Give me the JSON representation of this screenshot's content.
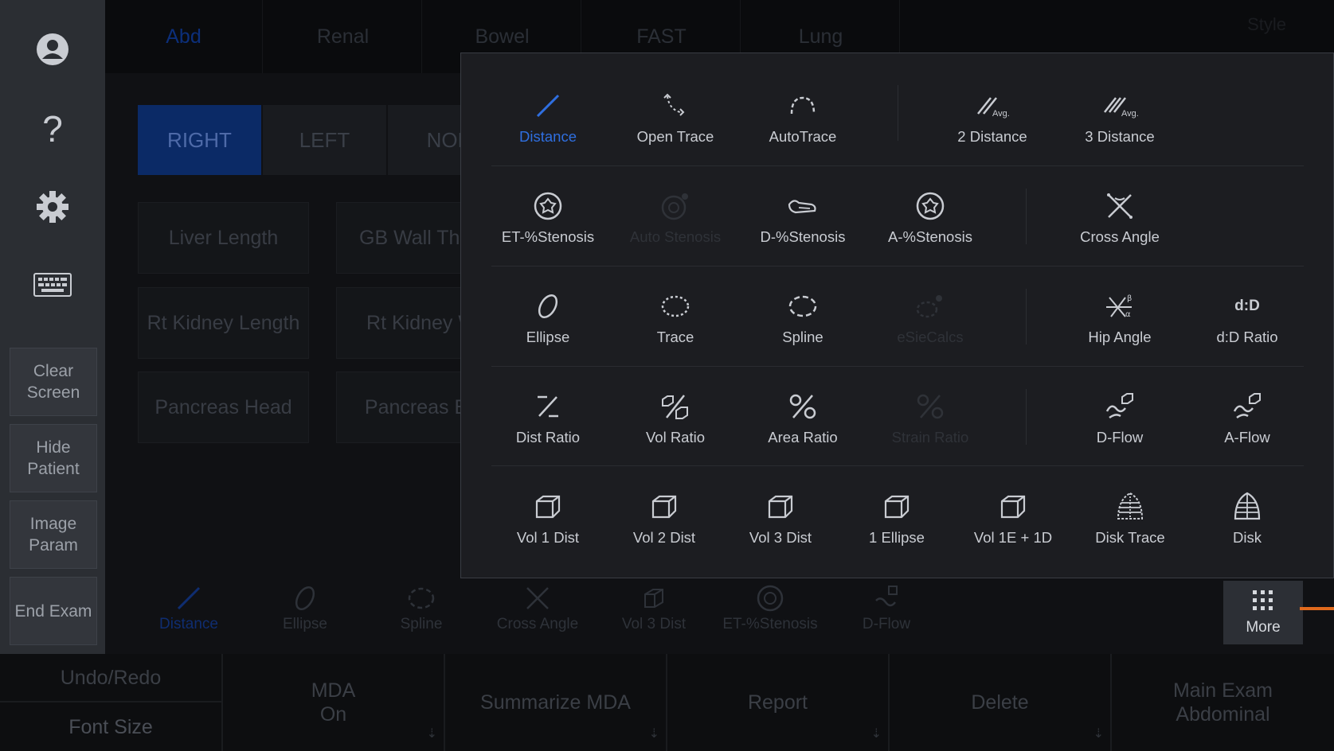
{
  "sidebar": {
    "icons": [
      "user-icon",
      "help-icon",
      "settings-icon",
      "keyboard-icon"
    ],
    "help_glyph": "?",
    "buttons": [
      "Clear\nScreen",
      "Hide\nPatient",
      "Image\nParam",
      "End Exam"
    ]
  },
  "tabs": [
    "Abd",
    "Renal",
    "Bowel",
    "FAST",
    "Lung"
  ],
  "tab_end": "Style",
  "side_toggles": [
    "RIGHT",
    "LEFT",
    "NON"
  ],
  "quick_measures": [
    "Liver Length",
    "GB Wall Thick",
    "Rt  Kidney Length",
    "Rt  Kidney W",
    "Pancreas Head",
    "Pancreas Bo"
  ],
  "tool_strip": [
    "Distance",
    "Ellipse",
    "Spline",
    "Cross Angle",
    "Vol 3 Dist",
    "ET-%Stenosis",
    "D-Flow"
  ],
  "more_label": "More",
  "softkeys": {
    "undo": "Undo/Redo",
    "font": "Font Size",
    "mda": "MDA\nOn",
    "summarize": "Summarize MDA",
    "report": "Report",
    "delete": "Delete",
    "main_exam": "Main Exam\nAbdominal"
  },
  "popup": {
    "row1": [
      "Distance",
      "Open Trace",
      "AutoTrace",
      "2 Distance",
      "3 Distance"
    ],
    "row2": [
      "ET-%Stenosis",
      "Auto Stenosis",
      "D-%Stenosis",
      "A-%Stenosis",
      "Cross Angle"
    ],
    "row3": [
      "Ellipse",
      "Trace",
      "Spline",
      "eSieCalcs",
      "Hip Angle",
      "d:D Ratio"
    ],
    "row4": [
      "Dist Ratio",
      "Vol Ratio",
      "Area Ratio",
      "Strain Ratio",
      "D-Flow",
      "A-Flow"
    ],
    "row5": [
      "Vol 1 Dist",
      "Vol 2 Dist",
      "Vol 3 Dist",
      "1 Ellipse",
      "Vol 1E + 1D",
      "Disk Trace",
      "Disk"
    ],
    "avg_badge": "Avg.",
    "dd_glyph": "d:D",
    "hip_alpha": "α",
    "hip_beta": "β"
  },
  "colors": {
    "accent": "#2f6fe0",
    "panel": "#1c1d21",
    "sidebar": "#2b2e33",
    "orange": "#e06a1d"
  }
}
